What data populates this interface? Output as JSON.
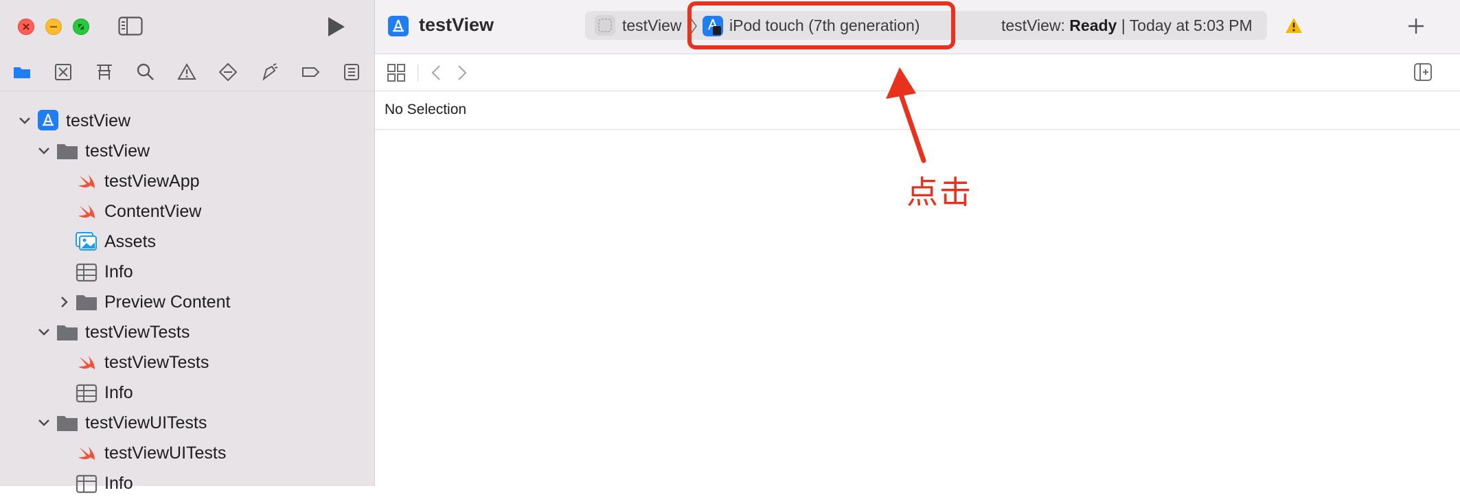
{
  "window": {
    "traffic_lights": [
      "close",
      "minimize",
      "zoom"
    ]
  },
  "toolbar": {
    "project_title": "testView",
    "scheme_name": "testView",
    "destination": "iPod touch (7th generation)",
    "status_project": "testView:",
    "status_state": "Ready",
    "status_time": "| Today at 5:03 PM",
    "warning_color": "#f5b800"
  },
  "navigator": {
    "icons": [
      "folder-icon",
      "source-control-icon",
      "symbol-icon",
      "find-icon",
      "issue-icon",
      "test-icon",
      "debug-icon",
      "breakpoint-icon",
      "report-icon"
    ],
    "active_color": "#1e7ef2",
    "tree": [
      {
        "label": "testView",
        "kind": "project"
      },
      {
        "label": "testView",
        "kind": "folder"
      },
      {
        "label": "testViewApp",
        "kind": "swift"
      },
      {
        "label": "ContentView",
        "kind": "swift"
      },
      {
        "label": "Assets",
        "kind": "assets"
      },
      {
        "label": "Info",
        "kind": "plist"
      },
      {
        "label": "Preview Content",
        "kind": "folder"
      },
      {
        "label": "testViewTests",
        "kind": "folder"
      },
      {
        "label": "testViewTests",
        "kind": "swift"
      },
      {
        "label": "Info",
        "kind": "plist"
      },
      {
        "label": "testViewUITests",
        "kind": "folder"
      },
      {
        "label": "testViewUITests",
        "kind": "swift"
      },
      {
        "label": "Info",
        "kind": "plist"
      }
    ]
  },
  "editor": {
    "no_selection": "No Selection"
  },
  "annotation": {
    "label": "点击",
    "color": "#e8321e"
  }
}
